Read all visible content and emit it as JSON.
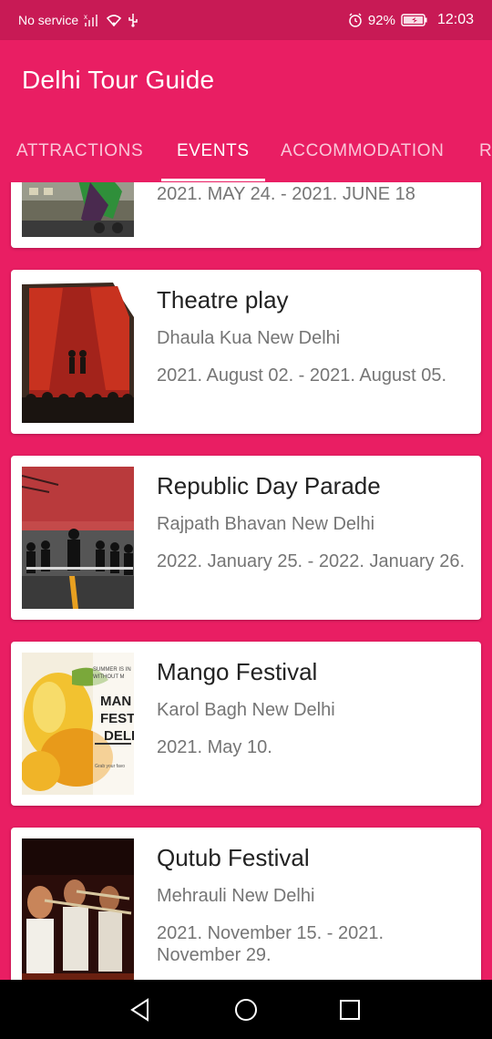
{
  "status_bar": {
    "carrier": "No service",
    "battery": "92%",
    "time": "12:03"
  },
  "app_bar": {
    "title": "Delhi Tour Guide"
  },
  "tabs": [
    {
      "label": "ATTRACTIONS",
      "active": false
    },
    {
      "label": "EVENTS",
      "active": true
    },
    {
      "label": "ACCOMMODATION",
      "active": false
    },
    {
      "label": "R",
      "active": false
    }
  ],
  "events": [
    {
      "title": "",
      "location": "",
      "dates": "2021. MAY 24. - 2021. JUNE 18"
    },
    {
      "title": "Theatre play",
      "location": "Dhaula Kua New Delhi",
      "dates": "2021. August 02. - 2021. August 05."
    },
    {
      "title": "Republic Day Parade",
      "location": "Rajpath Bhavan New Delhi",
      "dates": "2022. January 25. - 2022. January 26."
    },
    {
      "title": "Mango Festival",
      "location": "Karol Bagh New Delhi",
      "dates": "2021. May 10."
    },
    {
      "title": "Qutub Festival",
      "location": "Mehrauli New Delhi",
      "dates": "2021. November 15. - 2021. November 29."
    }
  ],
  "mango_poster": {
    "line1": "SUMMER IS IN",
    "line2": "WITHOUT M",
    "word1": "MAN",
    "word2": "FESTI",
    "word3": "DELI",
    "footer": "Grab your favo"
  }
}
